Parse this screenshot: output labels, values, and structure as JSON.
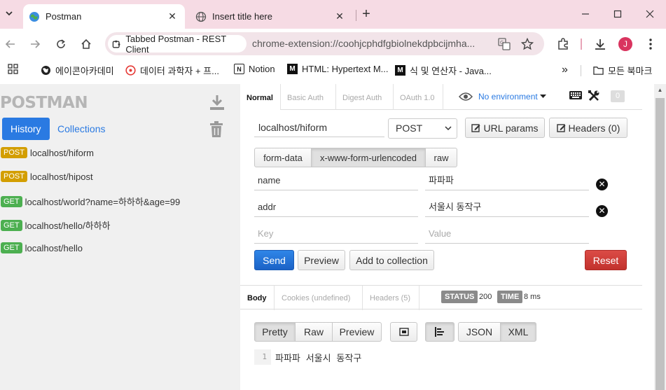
{
  "browser": {
    "tabs": [
      {
        "title": "Postman",
        "active": true
      },
      {
        "title": "Insert title here",
        "active": false
      }
    ],
    "site_chip": "Tabbed Postman - REST Client",
    "url": "chrome-extension://coohjcphdfgbiolnekdpbcijmha...",
    "profile_initial": "J",
    "bookmarks": [
      {
        "label": "에이콘아카데미",
        "icon": "globe-icon"
      },
      {
        "label": "데이터 과학자 + 프...",
        "icon": "site-icon"
      },
      {
        "label": "Notion",
        "icon": "notion-icon"
      },
      {
        "label": "HTML: Hypertext M...",
        "icon": "mdn-icon"
      },
      {
        "label": "식 및 연산자 - Java...",
        "icon": "mdn-icon"
      }
    ],
    "bookmarks_overflow": "»",
    "all_bookmarks": "모든 북마크"
  },
  "sidebar": {
    "logo": "POSTMAN",
    "tabs": {
      "history": "History",
      "collections": "Collections"
    },
    "history": [
      {
        "method": "POST",
        "url": "localhost/hiform"
      },
      {
        "method": "POST",
        "url": "localhost/hipost"
      },
      {
        "method": "GET",
        "url": "localhost/world?name=하하하&age=99"
      },
      {
        "method": "GET",
        "url": "localhost/hello/하하하"
      },
      {
        "method": "GET",
        "url": "localhost/hello"
      }
    ]
  },
  "auth_tabs": [
    "Normal",
    "Basic Auth",
    "Digest Auth",
    "OAuth 1.0"
  ],
  "environment": "No environment",
  "env_count": "0",
  "request": {
    "url": "localhost/hiform",
    "method": "POST",
    "url_params_label": "URL params",
    "headers_label": "Headers (0)",
    "body_modes": [
      "form-data",
      "x-www-form-urlencoded",
      "raw"
    ],
    "params": [
      {
        "key": "name",
        "value": "파파파"
      },
      {
        "key": "addr",
        "value": "서울시 동작구"
      }
    ],
    "key_placeholder": "Key",
    "value_placeholder": "Value",
    "send_label": "Send",
    "preview_label": "Preview",
    "add_collection_label": "Add to collection",
    "reset_label": "Reset"
  },
  "response": {
    "tabs": [
      "Body",
      "Cookies (undefined)",
      "Headers (5)"
    ],
    "status_label": "STATUS",
    "status_value": "200",
    "time_label": "TIME",
    "time_value": "8 ms",
    "formats": [
      "Pretty",
      "Raw",
      "Preview"
    ],
    "types": [
      "JSON",
      "XML"
    ],
    "line_number": "1",
    "body": "파파파 서울시 동작구"
  },
  "colors": {
    "post_badge": "#d39e00",
    "get_badge": "#4caf50",
    "accent": "#2a7ae2",
    "send": "#1f6fd6",
    "reset": "#d13f3a"
  }
}
